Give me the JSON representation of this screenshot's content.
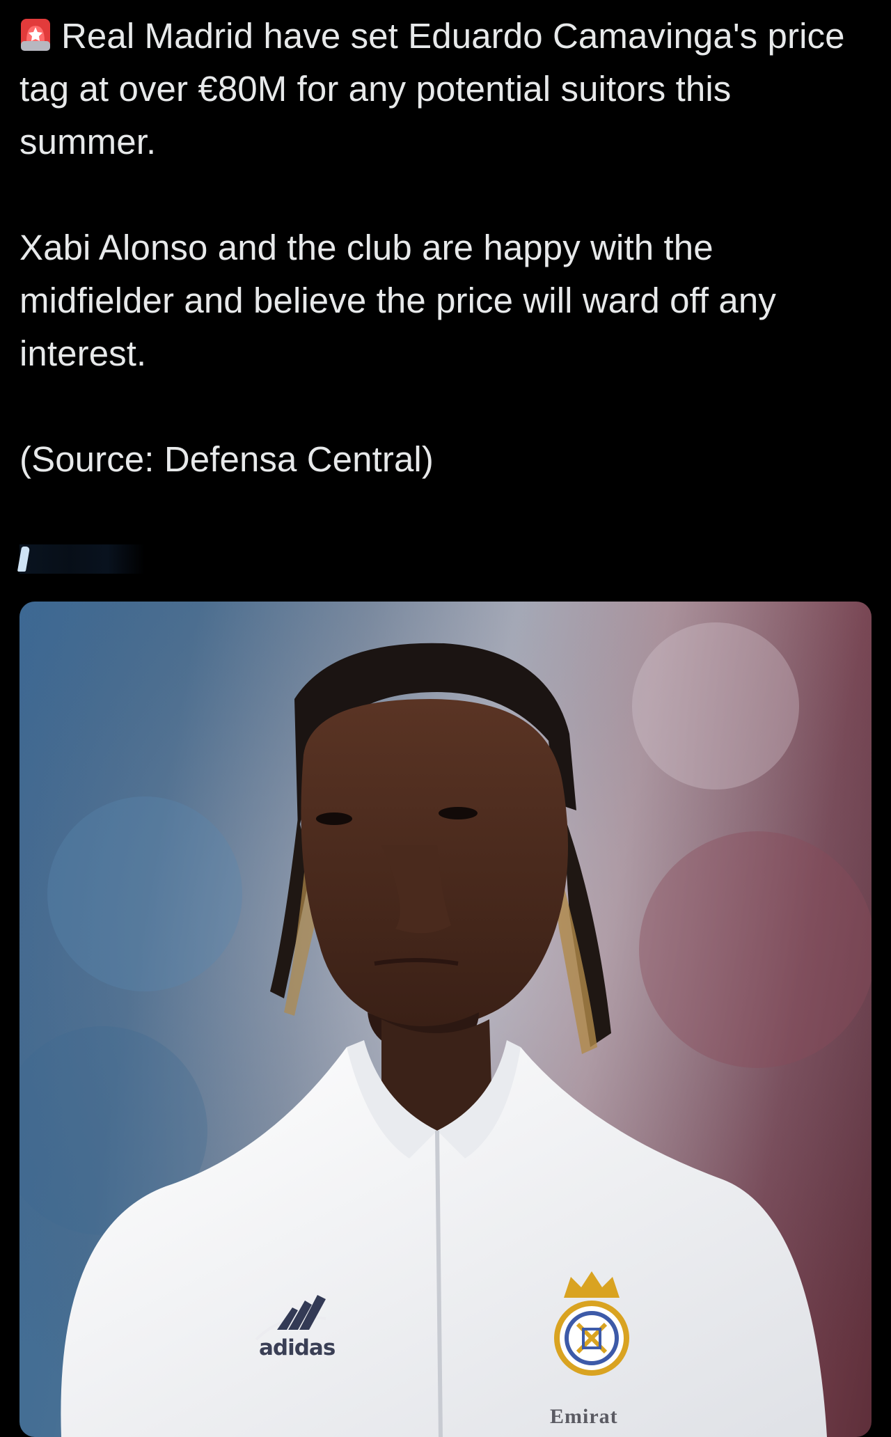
{
  "tweet": {
    "paragraphs": [
      {
        "icon": "police-car-light-icon",
        "text": "Real Madrid have set Eduardo Camavinga's price tag at over €80M for any potential suitors this summer."
      },
      {
        "text": "Xabi Alonso and the club are happy with the midfielder and believe the price will ward off any interest."
      },
      {
        "text": "(Source: Defensa Central)"
      }
    ]
  },
  "media": {
    "subject": "player-photo",
    "jacket_brand": "adidas",
    "sponsor_text": "Emirat"
  },
  "colors": {
    "background": "#000000",
    "text": "#e7e9ea",
    "jacket": "#f4f5f7",
    "crest_gold": "#d9a321"
  }
}
